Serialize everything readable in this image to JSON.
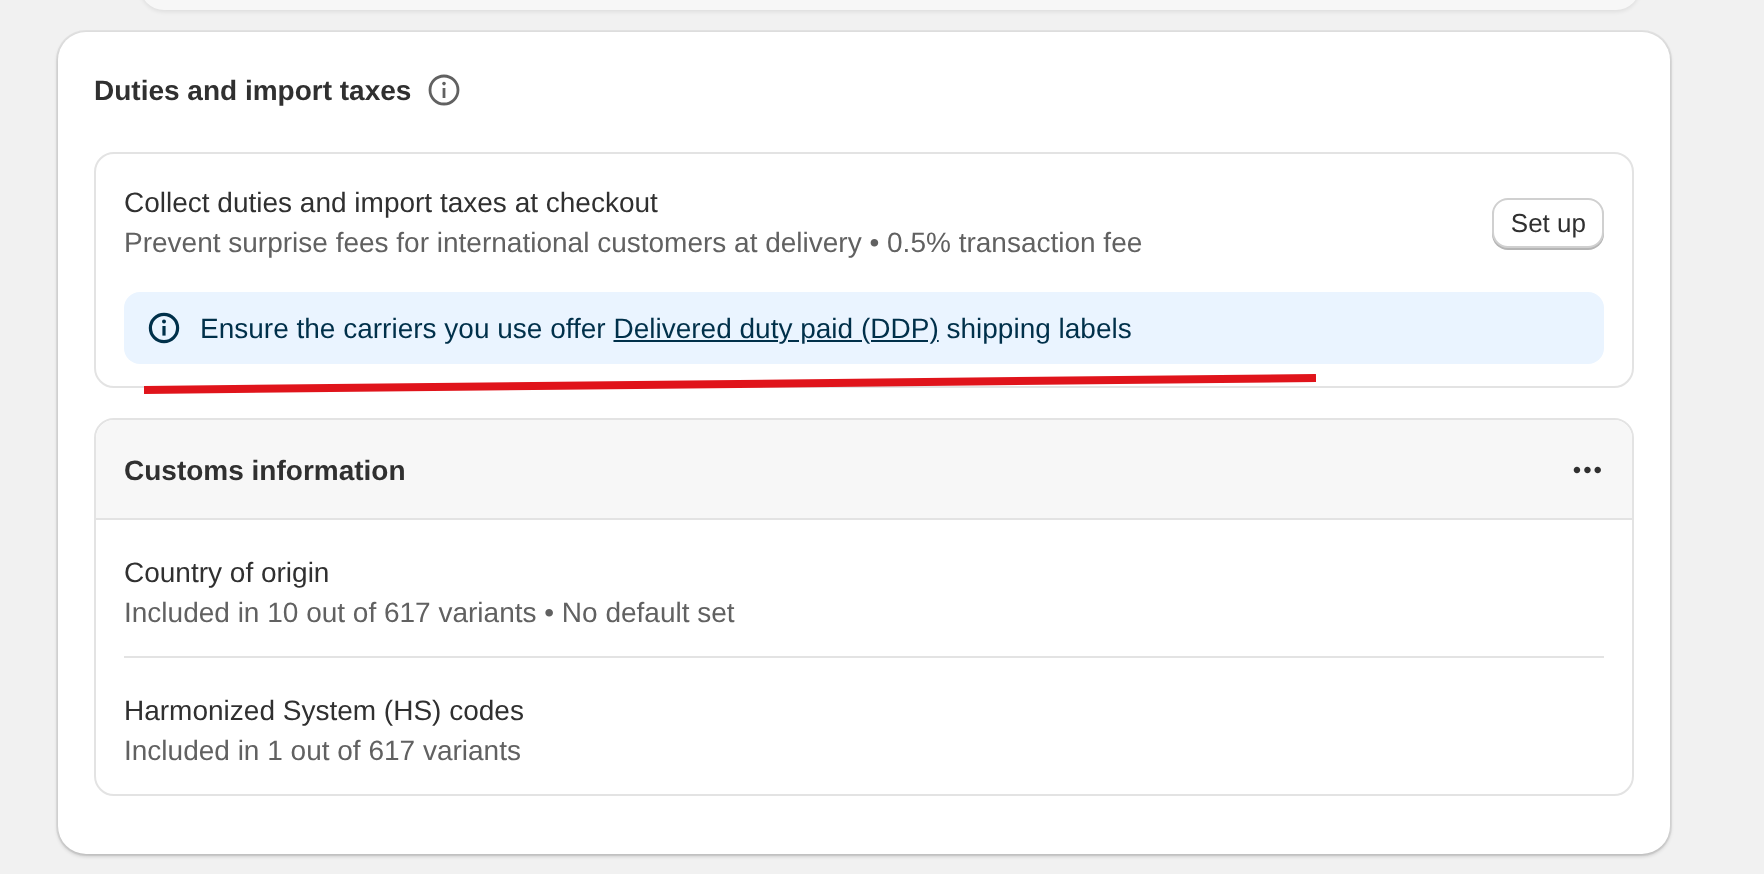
{
  "duties": {
    "title": "Duties and import taxes",
    "collect": {
      "title": "Collect duties and import taxes at checkout",
      "description": "Prevent surprise fees for international customers at delivery • 0.5% transaction fee",
      "button": "Set up",
      "banner": {
        "before": "Ensure the carriers you use offer ",
        "link": "Delivered duty paid (DDP)",
        "after": " shipping labels"
      }
    }
  },
  "customs": {
    "title": "Customs information",
    "menu": "•••",
    "items": [
      {
        "title": "Country of origin",
        "detail": "Included in 10 out of 617 variants • No default set"
      },
      {
        "title": "Harmonized System (HS) codes",
        "detail": "Included in 1 out of 617 variants"
      }
    ]
  }
}
